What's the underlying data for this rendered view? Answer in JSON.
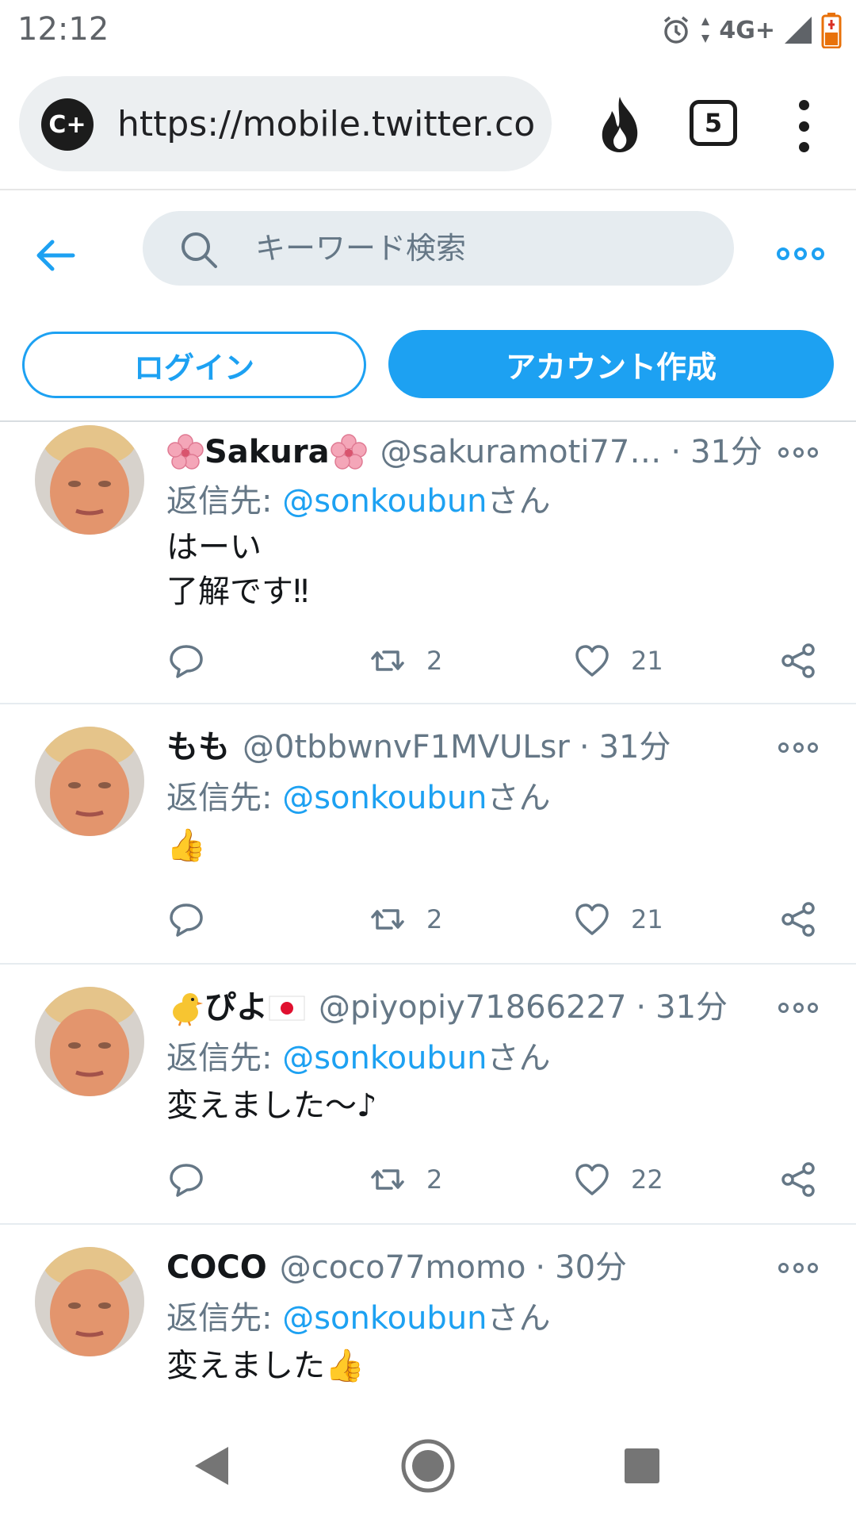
{
  "status_bar": {
    "time": "12:12",
    "network": "4G+"
  },
  "browser": {
    "site_badge": "C+",
    "url": "https://mobile.twitter.co",
    "tab_count": "5"
  },
  "twitter_header": {
    "search_placeholder": "キーワード検索",
    "login_label": "ログイン",
    "signup_label": "アカウント作成"
  },
  "tweets": [
    {
      "name": "Sakura",
      "handle": "@sakuramoti77…",
      "time": "31分",
      "reply_prefix": "返信先: ",
      "reply_to": "@sonkoubun",
      "reply_suffix": "さん",
      "lines": [
        "はーい",
        "了解です‼"
      ],
      "retweets": "2",
      "likes": "21"
    },
    {
      "name": "もも",
      "handle": "@0tbbwnvF1MVULsr",
      "time": "31分",
      "reply_prefix": "返信先: ",
      "reply_to": "@sonkoubun",
      "reply_suffix": "さん",
      "lines": [
        "👍"
      ],
      "retweets": "2",
      "likes": "21"
    },
    {
      "name": "ぴよ",
      "handle": "@piyopiy71866227",
      "time": "31分",
      "reply_prefix": "返信先: ",
      "reply_to": "@sonkoubun",
      "reply_suffix": "さん",
      "lines": [
        "変えました～♪"
      ],
      "retweets": "2",
      "likes": "22"
    },
    {
      "name": "COCO",
      "handle": "@coco77momo",
      "time": "30分",
      "reply_prefix": "返信先: ",
      "reply_to": "@sonkoubun",
      "reply_suffix": "さん",
      "lines": [
        "変えました👍"
      ]
    }
  ],
  "icons": {
    "browser": [
      "site-badge",
      "fire-icon",
      "tab-count",
      "overflow-menu-icon"
    ],
    "header": [
      "back-arrow-icon",
      "search-icon",
      "more-options-icon"
    ],
    "tweet_actions": [
      "reply-icon",
      "retweet-icon",
      "like-icon",
      "share-icon"
    ],
    "nav": [
      "back-nav-icon",
      "home-nav-icon",
      "recents-nav-icon"
    ]
  },
  "colors": {
    "accent": "#1da1f2",
    "secondary_text": "#657786",
    "primary_text": "#14171a"
  }
}
